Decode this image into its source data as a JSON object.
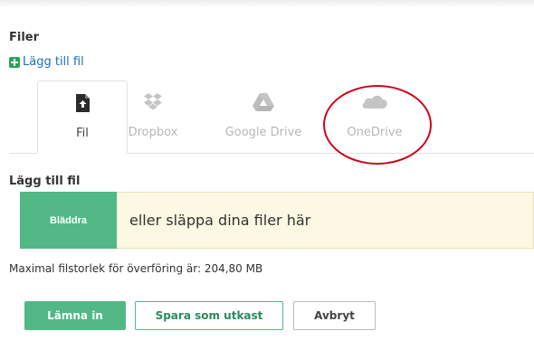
{
  "section": {
    "title": "Filer"
  },
  "add_file_link": {
    "label": "Lägg till fil",
    "icon": "plus-square-icon",
    "color": "#1e6fb5"
  },
  "tabs": [
    {
      "label": "Fil",
      "icon": "file-upload-icon",
      "active": true
    },
    {
      "label": "Dropbox",
      "icon": "dropbox-icon",
      "active": false
    },
    {
      "label": "Google Drive",
      "icon": "google-drive-icon",
      "active": false
    },
    {
      "label": "OneDrive",
      "icon": "onedrive-icon",
      "active": false
    }
  ],
  "annotation": {
    "color": "#d0021b"
  },
  "upload": {
    "title": "Lägg till fil",
    "browse_label": "Bläddra",
    "drop_text": "eller släppa dina filer här",
    "max_size": "Maximal filstorlek för överföring är: 204,80 MB"
  },
  "actions": {
    "submit": "Lämna in",
    "draft": "Spara som utkast",
    "cancel": "Avbryt"
  },
  "colors": {
    "accent_green": "#51b886",
    "drop_bg": "#fcf8e3"
  }
}
